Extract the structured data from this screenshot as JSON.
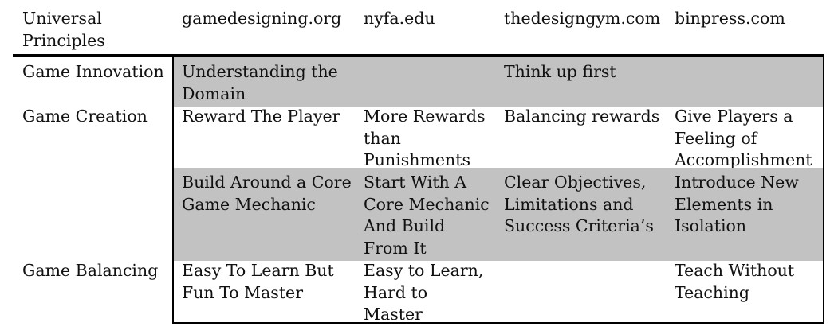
{
  "table": {
    "headers": [
      "Universal\nPrinciples",
      "gamedesigning.org",
      "nyfa.edu",
      "thedesigngym.com",
      "binpress.com"
    ],
    "rows": [
      {
        "shaded": true,
        "height": 56,
        "cells": [
          "Game Innovation",
          "Understanding the\nDomain",
          "",
          "Think up first",
          ""
        ]
      },
      {
        "shaded": false,
        "height": 83,
        "cells": [
          "Game Creation",
          "Reward The Player",
          "More Rewards\nthan\nPunishments",
          "Balancing rewards",
          "Give Players a\nFeeling of\nAccomplishment"
        ]
      },
      {
        "shaded": true,
        "height": 111,
        "cells": [
          "",
          "Build Around a Core\nGame Mechanic",
          "Start With A\nCore Mechanic\nAnd Build\nFrom It",
          "Clear Objectives,\nLimitations and\nSuccess Criteria’s",
          "Introduce New\nElements in\nIsolation"
        ]
      },
      {
        "shaded": false,
        "height": 84,
        "cells": [
          "Game Balancing",
          "Easy To Learn But\nFun To Master",
          "Easy to Learn,\nHard to\nMaster",
          "",
          "Teach Without\nTeaching"
        ]
      }
    ]
  }
}
